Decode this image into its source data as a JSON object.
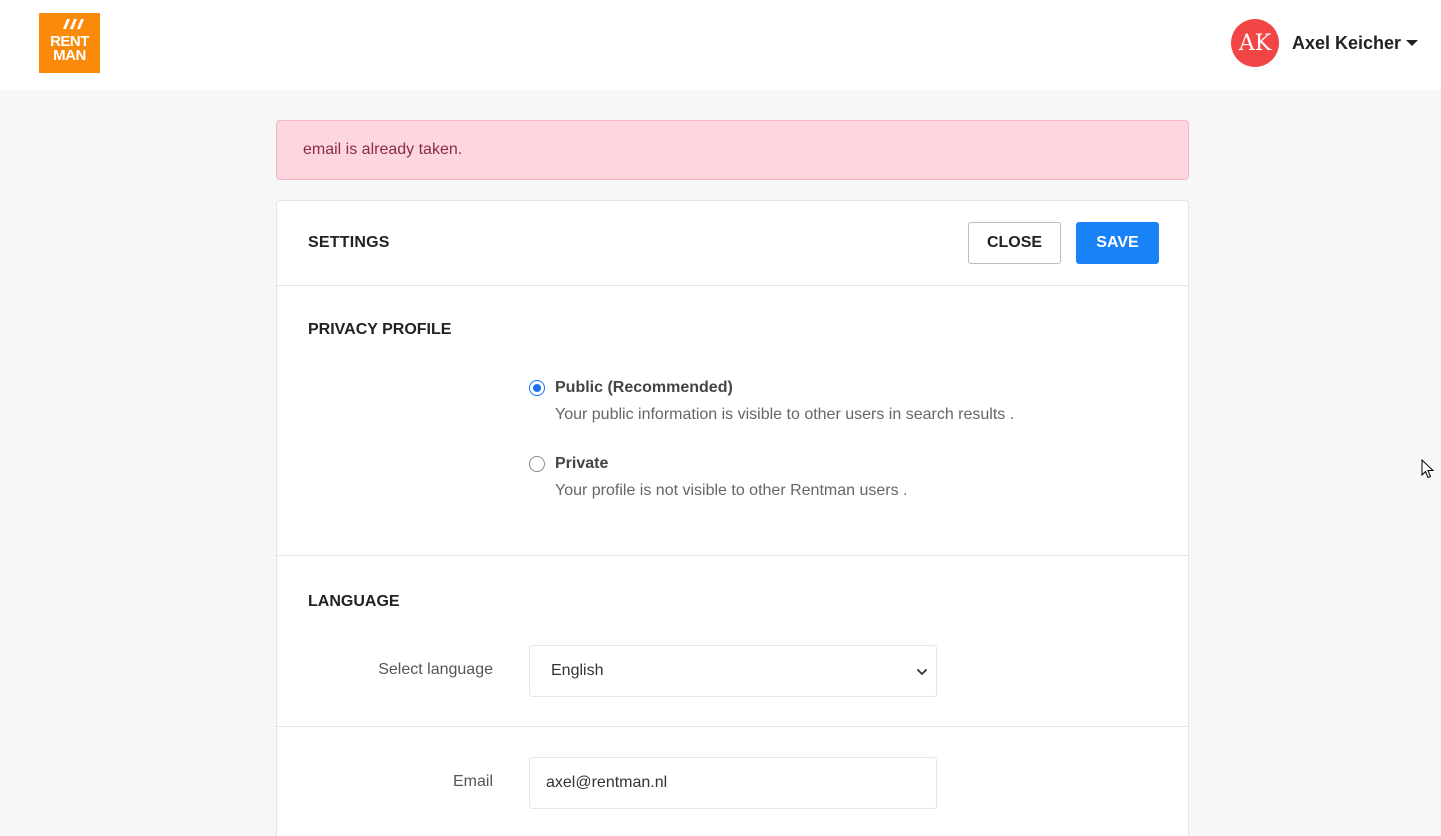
{
  "header": {
    "logo": {
      "line1": "RENT",
      "line2": "MAN",
      "color": "#f98a0a"
    },
    "user": {
      "initials": "AK",
      "name": "Axel Keicher",
      "avatar_color": "#f24545"
    }
  },
  "alert": {
    "message": "email is already taken."
  },
  "settings": {
    "title": "SETTINGS",
    "close_label": "CLOSE",
    "save_label": "SAVE",
    "accent_color": "#1a82f7",
    "privacy": {
      "title": "PRIVACY PROFILE",
      "options": [
        {
          "label": "Public (Recommended)",
          "description": "Your public information is visible to other users in search results .",
          "selected": true
        },
        {
          "label": "Private",
          "description": "Your profile is not visible to other Rentman users .",
          "selected": false
        }
      ]
    },
    "language": {
      "title": "LANGUAGE",
      "field_label": "Select language",
      "selected": "English"
    },
    "email": {
      "field_label": "Email",
      "value": "axel@rentman.nl"
    }
  }
}
